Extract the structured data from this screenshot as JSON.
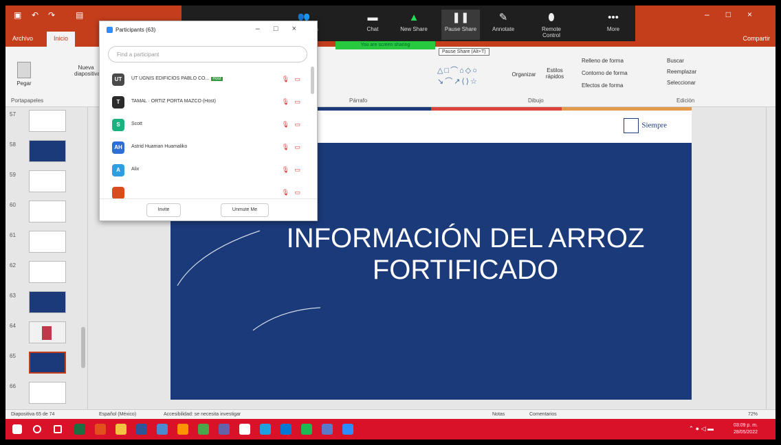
{
  "powerpoint": {
    "tabs": {
      "archivo": "Archivo",
      "inicio": "Inicio"
    },
    "share": "Compartir",
    "ribbon": {
      "paste": "Pegar",
      "clipboard_label": "Portapapeles",
      "new_slide": "Nueva diapositiva",
      "paragraph_label": "Párrafo",
      "drawing_label": "Dibujo",
      "arrange": "Organizar",
      "quick_styles": "Estilos rápidos",
      "shape_fill": "Relleno de forma",
      "shape_outline": "Contorno de forma",
      "shape_effects": "Efectos de forma",
      "find": "Buscar",
      "replace": "Reemplazar",
      "select": "Seleccionar",
      "editing_label": "Edición"
    },
    "thumbnails": [
      {
        "num": "57",
        "style": "white"
      },
      {
        "num": "58",
        "style": "blue"
      },
      {
        "num": "59",
        "style": "white"
      },
      {
        "num": "60",
        "style": "white"
      },
      {
        "num": "61",
        "style": "white"
      },
      {
        "num": "62",
        "style": "white"
      },
      {
        "num": "63",
        "style": "blue"
      },
      {
        "num": "64",
        "style": "pink"
      },
      {
        "num": "65",
        "style": "blue"
      },
      {
        "num": "66",
        "style": "white"
      }
    ],
    "slide": {
      "title_line1": "INFORMACIÓN DEL ARROZ",
      "title_line2": "FORTIFICADO",
      "logo": "Siempre",
      "stripe_colors": [
        "#1b3a7a",
        "#1b3a7a",
        "#d9433a",
        "#e39a4c"
      ],
      "background": "#1b3a7a"
    },
    "status": {
      "slide_count": "Diapositiva 65 de 74",
      "language": "Español (México)",
      "accessibility": "Accesibilidad: se necesita investigar",
      "notes": "Notas",
      "comments": "Comentarios",
      "zoom": "72%"
    }
  },
  "zoom_toolbar": {
    "buttons": [
      {
        "label": "Participants",
        "icon": "participants-icon"
      },
      {
        "label": "Chat",
        "icon": "chat-icon"
      },
      {
        "label": "New Share",
        "icon": "share-icon"
      },
      {
        "label": "Pause Share",
        "icon": "pause-icon"
      },
      {
        "label": "Annotate",
        "icon": "pen-icon"
      },
      {
        "label": "Remote Control",
        "icon": "mouse-icon"
      },
      {
        "label": "More",
        "icon": "more-icon"
      }
    ],
    "sharing_banner": "You are screen sharing",
    "pause_tooltip": "Pause Share (Alt+T)"
  },
  "participants_panel": {
    "title": "Participants (63)",
    "search_placeholder": "Find a participant",
    "participants": [
      {
        "initials": "UT",
        "name": "UT UGNIS EDIFICIOS PABLO CO...",
        "tag": "Host",
        "color": "#4a4a4a"
      },
      {
        "initials": "T",
        "name": "TAMAL · ORTIZ PORTA MAZCO (Host)",
        "tag": "",
        "color": "#2a2a2a"
      },
      {
        "initials": "S",
        "name": "Scott",
        "tag": "",
        "color": "#1ab37f"
      },
      {
        "initials": "AH",
        "name": "Astrid Huaman Huamaliko",
        "tag": "",
        "color": "#2d6fd6"
      },
      {
        "initials": "A",
        "name": "Alix",
        "tag": "",
        "color": "#2d9ee0"
      },
      {
        "initials": "",
        "name": "",
        "tag": "",
        "color": "#d94c1e"
      }
    ],
    "invite": "Invite",
    "unmute_me": "Unmute Me"
  },
  "taskbar": {
    "time": "03:09 p. m.",
    "date": "28/05/2022",
    "icons": [
      {
        "name": "search-icon",
        "color": "#ffffff"
      },
      {
        "name": "task-view-icon",
        "color": "#ffffff"
      },
      {
        "name": "excel-icon",
        "color": "#1d6f42"
      },
      {
        "name": "office-icon",
        "color": "#e2511b"
      },
      {
        "name": "explorer-icon",
        "color": "#f5c342"
      },
      {
        "name": "word-icon",
        "color": "#2b579a"
      },
      {
        "name": "app-icon",
        "color": "#4a8bd0"
      },
      {
        "name": "firefox-icon",
        "color": "#ff9400"
      },
      {
        "name": "chrome-icon",
        "color": "#4aa64a"
      },
      {
        "name": "teams-icon",
        "color": "#6264a7"
      },
      {
        "name": "store-icon",
        "color": "#ffffff"
      },
      {
        "name": "edge-icon",
        "color": "#1da1e0"
      },
      {
        "name": "onedrive-icon",
        "color": "#0078d4"
      },
      {
        "name": "spotify-icon",
        "color": "#1db954"
      },
      {
        "name": "photos-icon",
        "color": "#5a79c8"
      },
      {
        "name": "zoom-icon",
        "color": "#2d8cff"
      }
    ]
  }
}
